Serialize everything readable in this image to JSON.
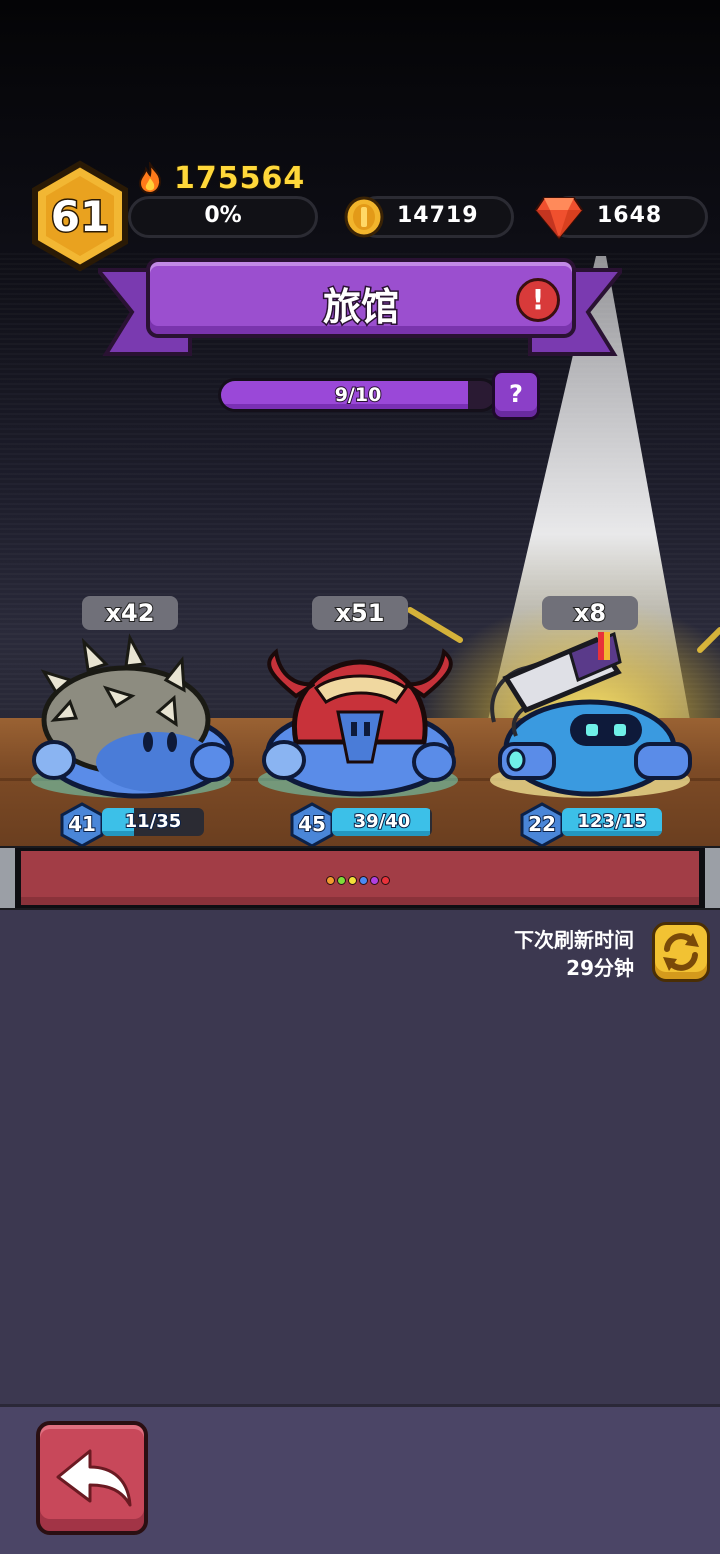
{
  "player": {
    "level": "61",
    "power": "175564",
    "xp_percent": "0%"
  },
  "currencies": {
    "coins": "14719",
    "gems": "1648"
  },
  "header": {
    "title": "旅馆",
    "alert_symbol": "!"
  },
  "inn_progress": {
    "label": "9/10",
    "fill_fraction": 0.9,
    "help_symbol": "?"
  },
  "heroes": [
    {
      "count": "x42",
      "level": "41",
      "shards": "11/35",
      "fill_fraction": 0.31,
      "type": "spiked-shell-slime"
    },
    {
      "count": "x51",
      "level": "45",
      "shards": "39/40",
      "fill_fraction": 0.975,
      "type": "horned-helmet-slime"
    },
    {
      "count": "x8",
      "level": "22",
      "shards": "123/15",
      "fill_fraction": 1.0,
      "type": "mech-cannon-slime"
    }
  ],
  "refresh": {
    "label": "下次刷新时间",
    "time": "29分钟"
  },
  "dots_colors": [
    "#f29a2e",
    "#7fdc3a",
    "#f2e03a",
    "#4a8af2",
    "#b040e0",
    "#e8323a"
  ],
  "colors": {
    "accent_purple": "#9b4fcf",
    "gold": "#ffd83a",
    "panel": "#3c3850",
    "back_button": "#c8485a"
  },
  "icons": {
    "fire": "fire-icon",
    "coin": "coin-icon",
    "gem": "gem-icon",
    "refresh": "refresh-icon",
    "back": "back-arrow-icon"
  }
}
